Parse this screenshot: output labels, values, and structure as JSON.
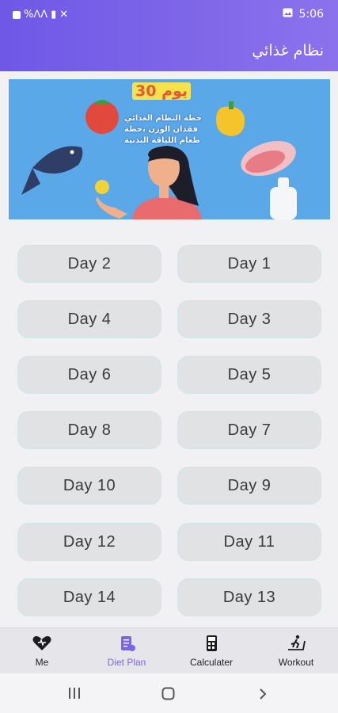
{
  "status_bar": {
    "time": "5:06",
    "left_text": "%ᐱᐱ"
  },
  "app_bar": {
    "title": "نظام غذائي"
  },
  "banner": {
    "heading": "30 يوم",
    "lines": [
      "خطة النظام الغذائي",
      "فقدان الوزن ،خطة",
      "طعام اللياقة البدنية"
    ]
  },
  "days": [
    {
      "left": "Day 2",
      "right": "Day 1"
    },
    {
      "left": "Day 4",
      "right": "Day 3"
    },
    {
      "left": "Day 6",
      "right": "Day 5"
    },
    {
      "left": "Day 8",
      "right": "Day 7"
    },
    {
      "left": "Day 10",
      "right": "Day 9"
    },
    {
      "left": "Day 12",
      "right": "Day 11"
    },
    {
      "left": "Day 14",
      "right": "Day 13"
    }
  ],
  "bottom_nav": {
    "items": [
      {
        "label": "Me",
        "icon": "heart-hand-icon"
      },
      {
        "label": "Diet Plan",
        "icon": "diet-clipboard-icon",
        "active": true
      },
      {
        "label": "Calculater",
        "icon": "calculator-icon"
      },
      {
        "label": "Workout",
        "icon": "treadmill-runner-icon"
      }
    ]
  },
  "colors": {
    "accent": "#7b66ea",
    "banner_bg": "#5aa8e8",
    "button_bg": "#e0e2e4"
  }
}
